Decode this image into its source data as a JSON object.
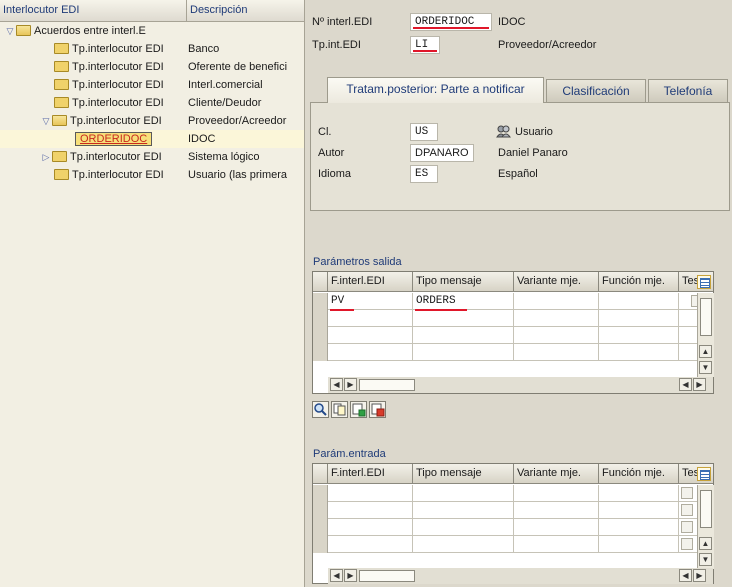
{
  "tree": {
    "col_interlocutor": "Interlocutor EDI",
    "col_descripcion": "Descripción",
    "rows": [
      {
        "label": "Acuerdos entre interl.E",
        "desc": "",
        "expander": "open"
      },
      {
        "label": "Tp.interlocutor EDI",
        "desc": "Banco",
        "expander": "none"
      },
      {
        "label": "Tp.interlocutor EDI",
        "desc": "Oferente de benefici",
        "expander": "none"
      },
      {
        "label": "Tp.interlocutor EDI",
        "desc": "Interl.comercial",
        "expander": "none"
      },
      {
        "label": "Tp.interlocutor EDI",
        "desc": "Cliente/Deudor",
        "expander": "none"
      },
      {
        "label": "Tp.interlocutor EDI",
        "desc": "Proveedor/Acreedor",
        "expander": "open"
      },
      {
        "label": "ORDERIDOC",
        "desc": "IDOC",
        "expander": "none"
      },
      {
        "label": "Tp.interlocutor EDI",
        "desc": "Sistema lógico",
        "expander": "closed"
      },
      {
        "label": "Tp.interlocutor EDI",
        "desc": "Usuario (las primera",
        "expander": "none"
      }
    ]
  },
  "header": {
    "partner_no_label": "Nº interl.EDI",
    "partner_no_value": "ORDERIDOC",
    "partner_no_desc": "IDOC",
    "partner_type_label": "Tp.int.EDI",
    "partner_type_value": "LI",
    "partner_type_desc": "Proveedor/Acreedor"
  },
  "tabs": [
    {
      "label": "Tratam.posterior: Parte a notificar",
      "active": true
    },
    {
      "label": "Clasificación",
      "active": false
    },
    {
      "label": "Telefonía",
      "active": false
    }
  ],
  "notify": {
    "cl_label": "Cl.",
    "cl_value": "US",
    "cl_desc": "Usuario",
    "author_label": "Autor",
    "author_value": "DPANARO",
    "author_desc": "Daniel Panaro",
    "lang_label": "Idioma",
    "lang_value": "ES",
    "lang_desc": "Español"
  },
  "outbound": {
    "title": "Parámetros salida",
    "columns": [
      "F.interl.EDI",
      "Tipo mensaje",
      "Variante mje.",
      "Función mje.",
      "Test"
    ],
    "rows": [
      [
        "PV",
        "ORDERS",
        "",
        "",
        ""
      ],
      [
        "",
        "",
        "",
        "",
        ""
      ],
      [
        "",
        "",
        "",
        "",
        ""
      ],
      [
        "",
        "",
        "",
        "",
        ""
      ]
    ]
  },
  "inbound": {
    "title": "Parám.entrada",
    "columns": [
      "F.interl.EDI",
      "Tipo mensaje",
      "Variante mje.",
      "Función mje.",
      "Test"
    ],
    "rows": [
      [
        "",
        "",
        "",
        "",
        ""
      ],
      [
        "",
        "",
        "",
        "",
        ""
      ],
      [
        "",
        "",
        "",
        "",
        ""
      ],
      [
        "",
        "",
        "",
        "",
        ""
      ]
    ]
  },
  "colors": {
    "highlight_underline": "#e0172a",
    "selected_node_bg": "#f7e07a",
    "label_blue": "#1f3b78"
  },
  "icons": [
    "tree-collapse-icon",
    "tree-expand-icon",
    "folder-icon",
    "user-group-icon",
    "column-config-icon",
    "detail-icon",
    "copy-icon",
    "create-icon",
    "delete-icon"
  ]
}
